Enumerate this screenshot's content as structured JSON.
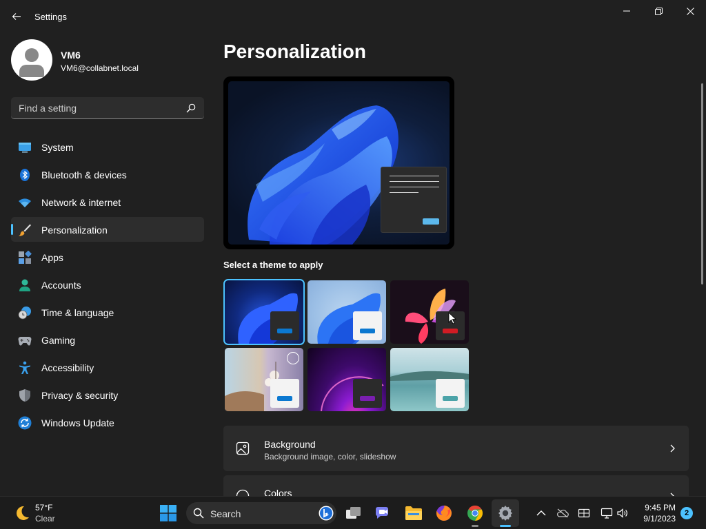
{
  "window": {
    "title": "Settings"
  },
  "profile": {
    "name": "VM6",
    "email": "VM6@collabnet.local"
  },
  "search": {
    "placeholder": "Find a setting"
  },
  "sidebar": {
    "items": [
      {
        "label": "System",
        "icon": "system-icon"
      },
      {
        "label": "Bluetooth & devices",
        "icon": "bluetooth-icon"
      },
      {
        "label": "Network & internet",
        "icon": "wifi-icon"
      },
      {
        "label": "Personalization",
        "icon": "brush-icon",
        "active": true
      },
      {
        "label": "Apps",
        "icon": "apps-icon"
      },
      {
        "label": "Accounts",
        "icon": "accounts-icon"
      },
      {
        "label": "Time & language",
        "icon": "globe-clock-icon"
      },
      {
        "label": "Gaming",
        "icon": "gamepad-icon"
      },
      {
        "label": "Accessibility",
        "icon": "accessibility-icon"
      },
      {
        "label": "Privacy & security",
        "icon": "shield-icon"
      },
      {
        "label": "Windows Update",
        "icon": "update-icon"
      }
    ]
  },
  "main": {
    "title": "Personalization",
    "theme_heading": "Select a theme to apply",
    "themes": [
      {
        "name": "windows-dark",
        "selected": true
      },
      {
        "name": "windows-light"
      },
      {
        "name": "glow"
      },
      {
        "name": "captured-motion"
      },
      {
        "name": "sunrise"
      },
      {
        "name": "flow"
      }
    ],
    "rows": [
      {
        "title": "Background",
        "subtitle": "Background image, color, slideshow",
        "icon": "image-icon"
      },
      {
        "title": "Colors",
        "subtitle": "",
        "icon": "palette-icon"
      }
    ]
  },
  "taskbar": {
    "weather": {
      "temp": "57°F",
      "condition": "Clear"
    },
    "search_label": "Search",
    "clock": {
      "time": "9:45 PM",
      "date": "9/1/2023"
    },
    "notifications": "2"
  },
  "colors": {
    "accent": "#4cc2ff",
    "background": "#202020",
    "card": "#2b2b2b"
  }
}
